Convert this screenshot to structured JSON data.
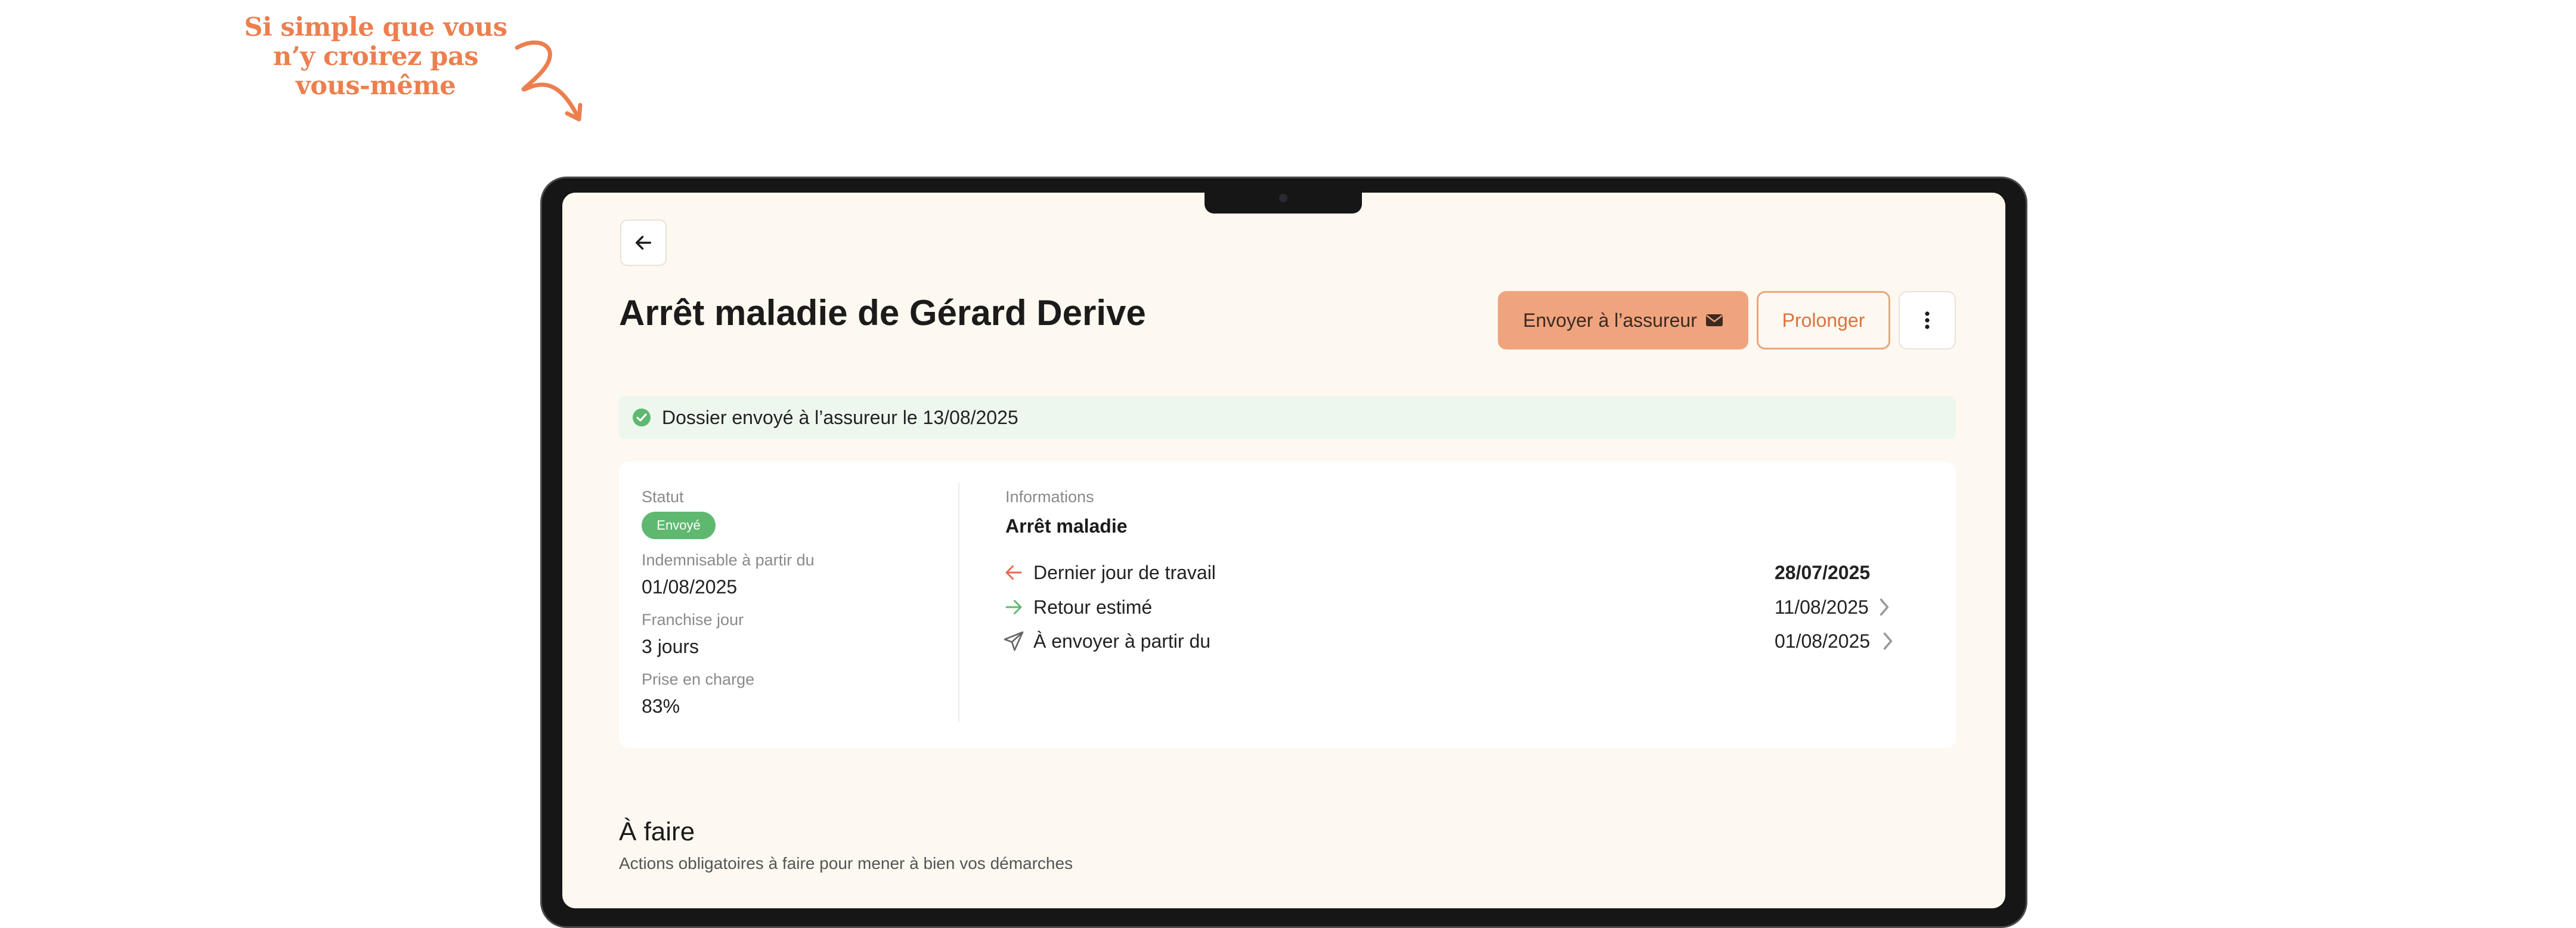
{
  "tagline": {
    "line1": "Si simple que vous",
    "line2": "n’y croirez pas",
    "line3": "vous-même"
  },
  "colors": {
    "accent": "#ec7f4f",
    "primary_button": "#f0a47e",
    "success": "#5fb86f",
    "alert_bg": "#eef7ee",
    "screen_bg": "#fdf8f0"
  },
  "header": {
    "back_icon": "arrow-left-icon",
    "title": "Arrêt maladie de Gérard Derive",
    "send_button": "Envoyer à l’assureur",
    "send_icon": "envelope-icon",
    "prolong_button": "Prolonger",
    "more_icon": "vertical-dots-icon"
  },
  "alert": {
    "icon": "check-circle-icon",
    "text": "Dossier envoyé à l’assureur le 13/08/2025"
  },
  "summary": {
    "status_label": "Statut",
    "status_badge": "Envoyé",
    "indemnisable_label": "Indemnisable à partir du",
    "indemnisable_value": "01/08/2025",
    "franchise_label": "Franchise jour",
    "franchise_value": "3 jours",
    "prise_label": "Prise en charge",
    "prise_value": "83%"
  },
  "informations": {
    "label": "Informations",
    "type": "Arrêt maladie",
    "rows": [
      {
        "icon": "arrow-left-icon",
        "label": "Dernier jour de travail",
        "value": "28/07/2025"
      },
      {
        "icon": "arrow-right-icon",
        "label": "Retour estimé",
        "value": "11/08/2025"
      },
      {
        "icon": "paper-plane-icon",
        "label": "À envoyer à partir du",
        "value": "01/08/2025"
      }
    ]
  },
  "todo": {
    "title": "À faire",
    "subtitle": "Actions obligatoires à faire pour mener à bien vos démarches"
  }
}
